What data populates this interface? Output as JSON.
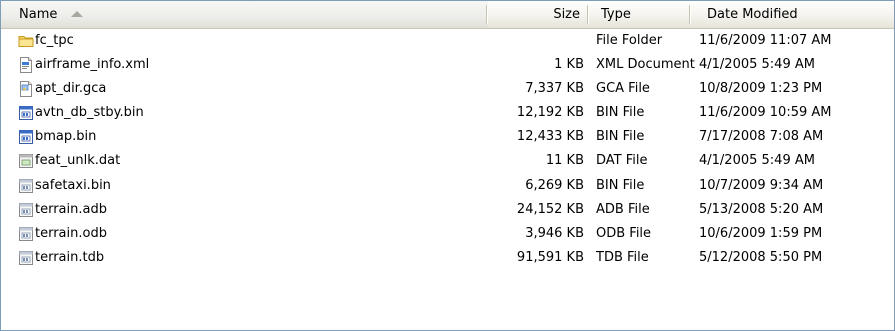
{
  "columns": {
    "name": "Name",
    "size": "Size",
    "type": "Type",
    "date": "Date Modified"
  },
  "files": [
    {
      "name": "fc_tpc",
      "size": "",
      "type": "File Folder",
      "date": "11/6/2009 11:07 AM",
      "icon": "folder-icon"
    },
    {
      "name": "airframe_info.xml",
      "size": "1 KB",
      "type": "XML Document",
      "date": "4/1/2005 5:49 AM",
      "icon": "xml-file-icon"
    },
    {
      "name": "apt_dir.gca",
      "size": "7,337 KB",
      "type": "GCA File",
      "date": "10/8/2009 1:23 PM",
      "icon": "gca-file-icon"
    },
    {
      "name": "avtn_db_stby.bin",
      "size": "12,192 KB",
      "type": "BIN File",
      "date": "11/6/2009 10:59 AM",
      "icon": "bin-file-icon"
    },
    {
      "name": "bmap.bin",
      "size": "12,433 KB",
      "type": "BIN File",
      "date": "7/17/2008 7:08 AM",
      "icon": "bin-file-icon"
    },
    {
      "name": "feat_unlk.dat",
      "size": "11 KB",
      "type": "DAT File",
      "date": "4/1/2005 5:49 AM",
      "icon": "dat-file-icon"
    },
    {
      "name": "safetaxi.bin",
      "size": "6,269 KB",
      "type": "BIN File",
      "date": "10/7/2009 9:34 AM",
      "icon": "generic-file-icon"
    },
    {
      "name": "terrain.adb",
      "size": "24,152 KB",
      "type": "ADB File",
      "date": "5/13/2008 5:20 AM",
      "icon": "generic-file-icon"
    },
    {
      "name": "terrain.odb",
      "size": "3,946 KB",
      "type": "ODB File",
      "date": "10/6/2009 1:59 PM",
      "icon": "generic-file-icon"
    },
    {
      "name": "terrain.tdb",
      "size": "91,591 KB",
      "type": "TDB File",
      "date": "5/12/2008 5:50 PM",
      "icon": "generic-file-icon"
    }
  ]
}
